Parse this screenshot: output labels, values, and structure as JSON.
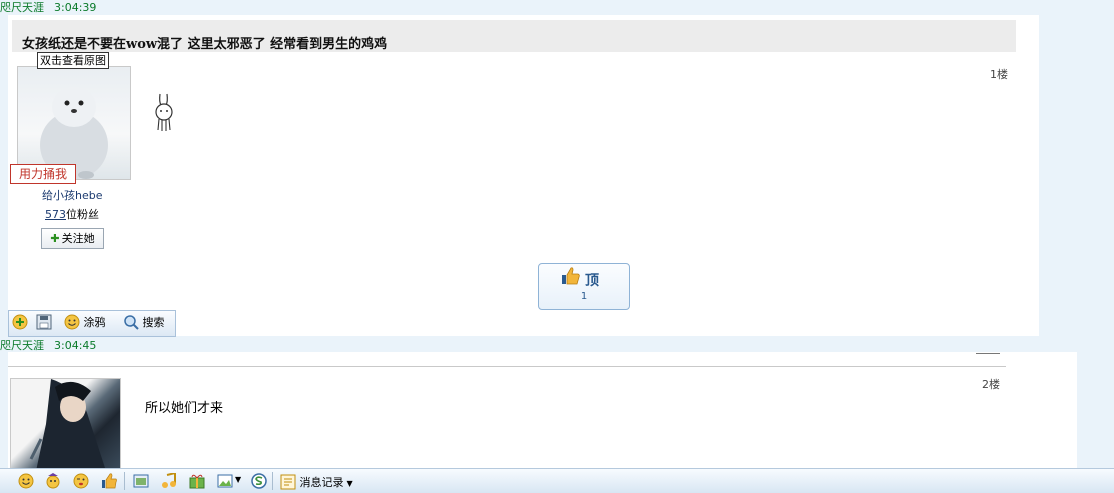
{
  "messages": [
    {
      "sender": "咫尺天涯",
      "time": "3:04:39",
      "title": "女孩纸还是不要在wow混了 这里太邪恶了 经常看到男生的鸡鸡",
      "avatar_tip": "双击查看原图",
      "poke_label": "用力捅我",
      "author": "给小孩hebe",
      "fans_count": "573",
      "fans_suffix": "位粉丝",
      "follow_label": "关注她",
      "floor": "1楼",
      "ding_label": "顶",
      "ding_count": "1"
    },
    {
      "sender": "咫尺天涯",
      "time": "3:04:45",
      "floor": "2楼",
      "text": "所以她们才来"
    }
  ],
  "post_toolbar": {
    "graffiti_label": "涂鸦",
    "search_label": "搜索"
  },
  "bottom_toolbar": {
    "message_log_label": "消息记录"
  },
  "colors": {
    "sender": "#0a7a2a",
    "accent": "#2a5a8f",
    "poke": "#c0352b"
  }
}
